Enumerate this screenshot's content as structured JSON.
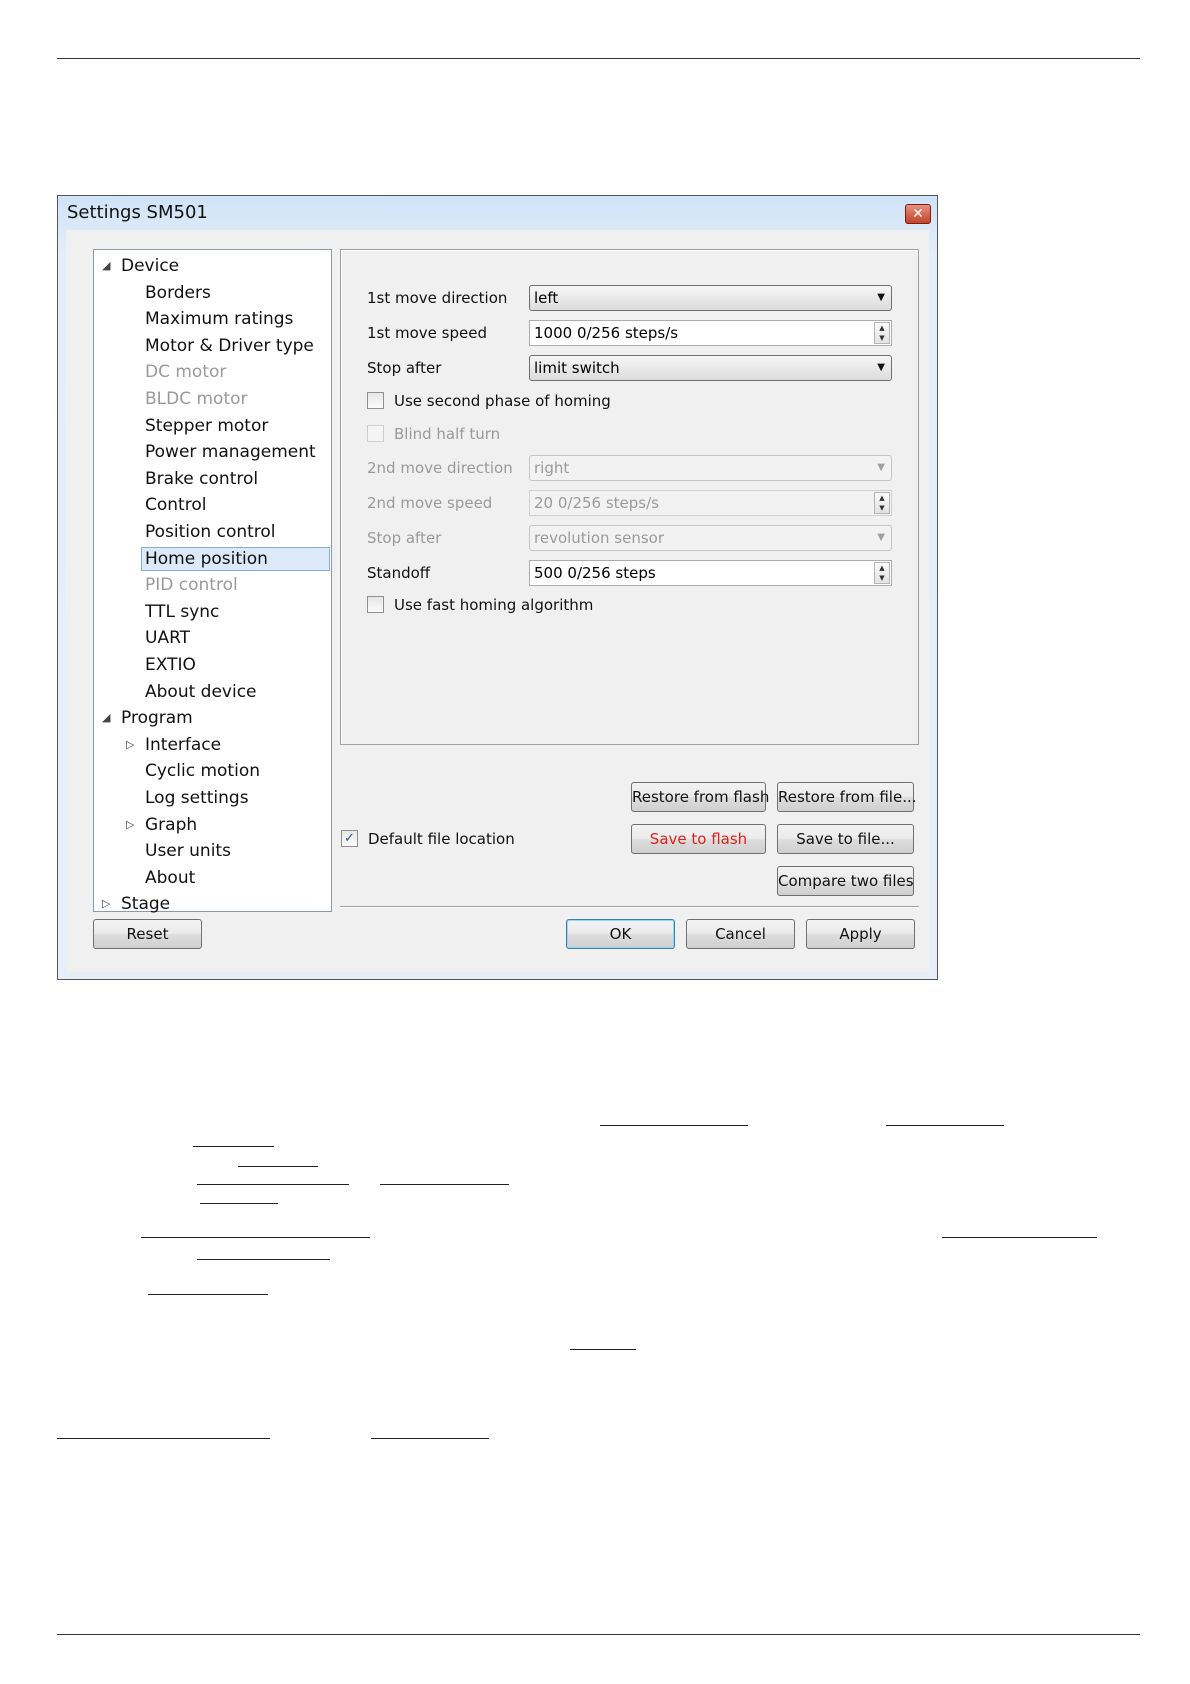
{
  "window": {
    "title": "Settings SM501",
    "close_glyph": "✕"
  },
  "tree": {
    "items": [
      {
        "label": "Device",
        "state": "expanded"
      },
      {
        "label": "Borders"
      },
      {
        "label": "Maximum ratings"
      },
      {
        "label": "Motor & Driver type"
      },
      {
        "label": "DC motor",
        "disabled": true
      },
      {
        "label": "BLDC motor",
        "disabled": true
      },
      {
        "label": "Stepper motor"
      },
      {
        "label": "Power management"
      },
      {
        "label": "Brake control"
      },
      {
        "label": "Control"
      },
      {
        "label": "Position control"
      },
      {
        "label": "Home position",
        "selected": true
      },
      {
        "label": "PID control",
        "disabled": true
      },
      {
        "label": "TTL sync"
      },
      {
        "label": "UART"
      },
      {
        "label": "EXTIO"
      },
      {
        "label": "About device"
      },
      {
        "label": "Program",
        "state": "expanded"
      },
      {
        "label": "Interface",
        "state": "collapsed"
      },
      {
        "label": "Cyclic motion"
      },
      {
        "label": "Log settings"
      },
      {
        "label": "Graph",
        "state": "collapsed"
      },
      {
        "label": "User units"
      },
      {
        "label": "About"
      },
      {
        "label": "Stage",
        "state": "collapsed"
      }
    ]
  },
  "home": {
    "first_dir_label": "1st move direction",
    "first_dir_value": "left",
    "first_speed_label": "1st move speed",
    "first_speed_value": "1000 0/256 steps/s",
    "stop_after_label": "Stop after",
    "stop_after_value": "limit switch",
    "second_phase_label": "Use second phase of homing",
    "second_phase_checked": false,
    "blind_half_turn_label": "Blind half turn",
    "second_dir_label": "2nd move direction",
    "second_dir_value": "right",
    "second_speed_label": "2nd move speed",
    "second_speed_value": "20 0/256 steps/s",
    "stop_after2_label": "Stop after",
    "stop_after2_value": "revolution sensor",
    "standoff_label": "Standoff",
    "standoff_value": "500 0/256 steps",
    "fast_homing_label": "Use fast homing algorithm",
    "fast_homing_checked": false
  },
  "file": {
    "default_location_label": "Default file location",
    "default_location_checked": true,
    "check_glyph": "✓",
    "restore_flash": "Restore from flash",
    "restore_file": "Restore from file...",
    "save_flash": "Save to flash",
    "save_file": "Save to file...",
    "compare": "Compare two files"
  },
  "footer": {
    "reset": "Reset",
    "ok": "OK",
    "cancel": "Cancel",
    "apply": "Apply"
  },
  "glyphs": {
    "expanded": "◢",
    "collapsed": "▷",
    "dropdown": "▼",
    "spin_up": "▲",
    "spin_down": "▼"
  },
  "colors": {
    "save_flash_text": "#e0201a",
    "selection_bg": "#dbe9f9"
  }
}
